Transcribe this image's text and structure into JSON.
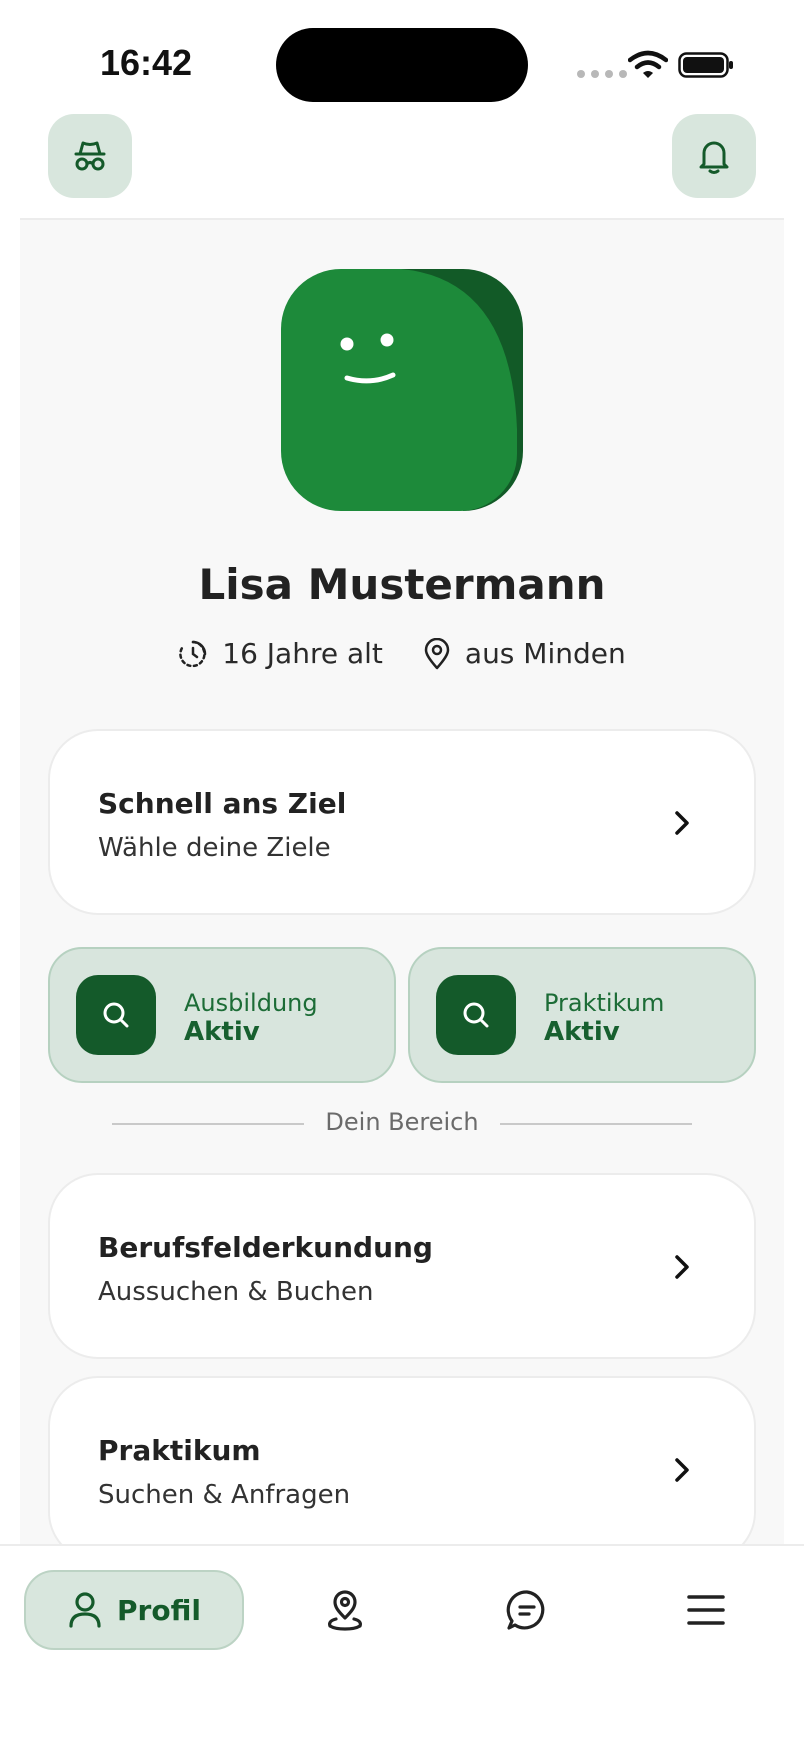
{
  "status_bar": {
    "time": "16:42"
  },
  "header": {
    "left_icon": "incognito-icon",
    "right_icon": "bell-icon"
  },
  "profile": {
    "name": "Lisa Mustermann",
    "age": "16 Jahre alt",
    "location": "aus Minden"
  },
  "quick_card": {
    "title": "Schnell ans Ziel",
    "subtitle": "Wähle deine Ziele"
  },
  "status_cards": [
    {
      "label": "Ausbildung",
      "value": "Aktiv",
      "icon": "search-icon"
    },
    {
      "label": "Praktikum",
      "value": "Aktiv",
      "icon": "search-icon"
    }
  ],
  "section_divider": "Dein Bereich",
  "area_cards": [
    {
      "title": "Berufsfelderkundung",
      "subtitle": "Aussuchen & Buchen"
    },
    {
      "title": "Praktikum",
      "subtitle": "Suchen & Anfragen"
    }
  ],
  "tabbar": {
    "active_label": "Profil",
    "items": [
      "user-icon",
      "map-pin-icon",
      "chat-icon",
      "menu-icon"
    ]
  },
  "colors": {
    "brand_green": "#1d8a3a",
    "dark_green": "#145a2a",
    "soft_green": "#d8e6dd"
  }
}
